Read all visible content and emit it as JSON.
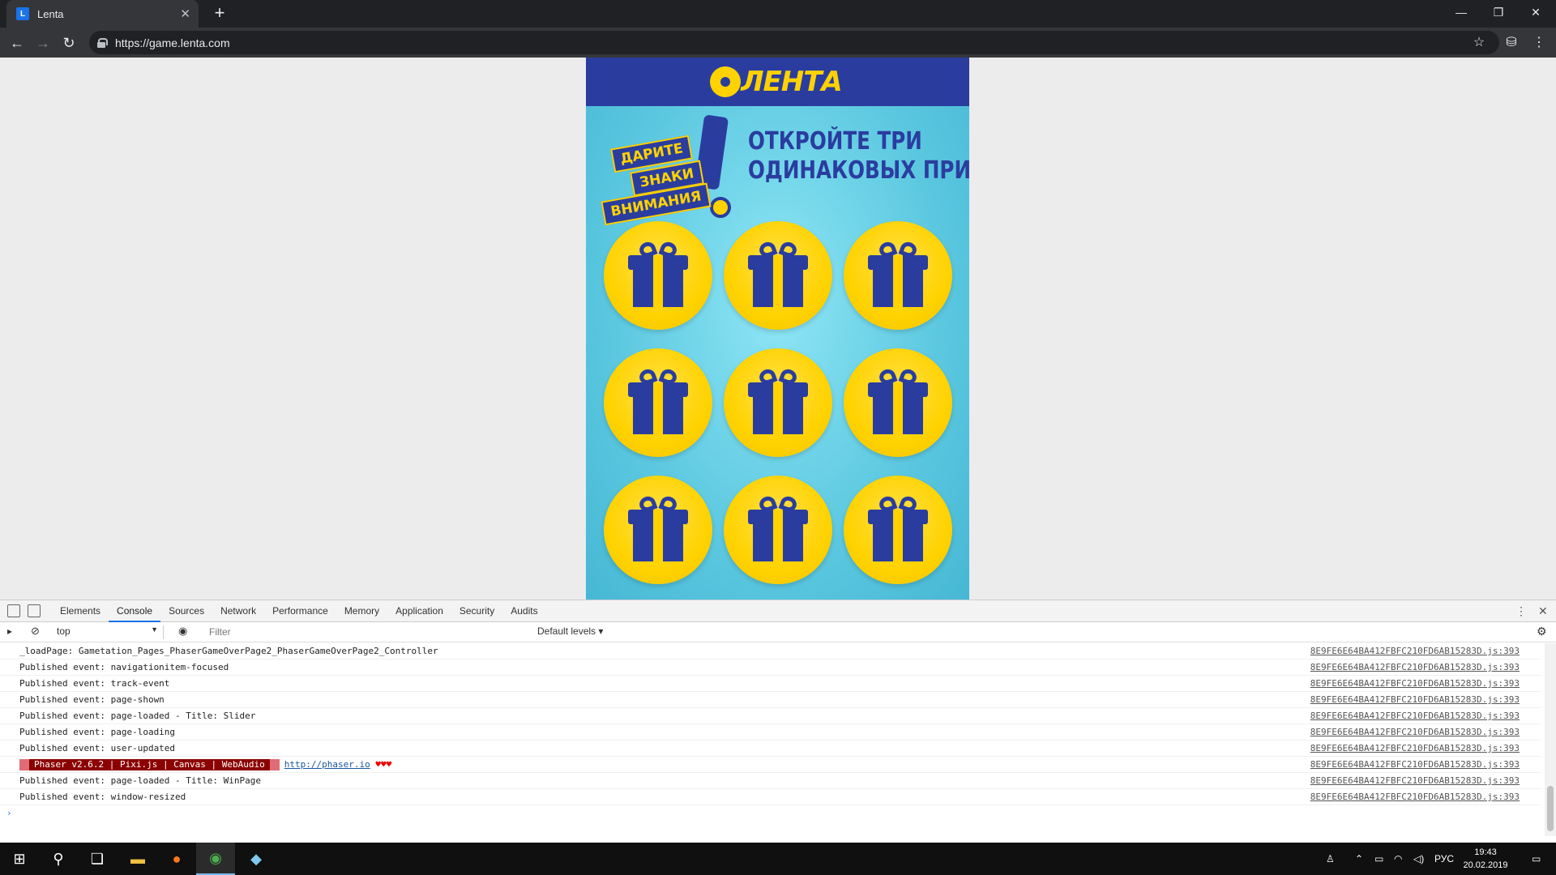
{
  "browser": {
    "tab_title": "Lenta",
    "tab_favicon": "lenta-favicon-icon",
    "url": "https://game.lenta.com"
  },
  "game": {
    "logo_text": "ЛЕНТА",
    "promo_lines": [
      "ДАРИТЕ",
      "ЗНАКИ",
      "ВНИМАНИЯ"
    ],
    "headline_1": "ОТКРОЙТЕ ТРИ",
    "headline_2": "ОДИНАКОВЫХ ПРИЗА!",
    "prizes": 9,
    "colors": {
      "brand_blue": "#2a3d9f",
      "brand_yellow": "#ffd200",
      "background": "#5cc8e0"
    }
  },
  "devtools": {
    "tabs": [
      "Elements",
      "Console",
      "Sources",
      "Network",
      "Performance",
      "Memory",
      "Application",
      "Security",
      "Audits"
    ],
    "active_tab": "Console",
    "context": "top",
    "filter_placeholder": "Filter",
    "levels": "Default levels ▾",
    "logs": [
      {
        "text": "_loadPage: Gametation_Pages_PhaserGameOverPage2_PhaserGameOverPage2_Controller",
        "src": "8E9FE6E64BA412FBFC210FD6AB15283D.js:393"
      },
      {
        "text": "Published event: navigationitem-focused",
        "src": "8E9FE6E64BA412FBFC210FD6AB15283D.js:393"
      },
      {
        "text": "Published event: track-event",
        "src": "8E9FE6E64BA412FBFC210FD6AB15283D.js:393"
      },
      {
        "text": "Published event: page-shown",
        "src": "8E9FE6E64BA412FBFC210FD6AB15283D.js:393"
      },
      {
        "text": "Published event: page-loaded - Title: Slider",
        "src": "8E9FE6E64BA412FBFC210FD6AB15283D.js:393"
      },
      {
        "text": "Published event: page-loading",
        "src": "8E9FE6E64BA412FBFC210FD6AB15283D.js:393"
      },
      {
        "text": "Published event: user-updated",
        "src": "8E9FE6E64BA412FBFC210FD6AB15283D.js:393"
      },
      {
        "text": "Published event: page-loaded - Title: WinPage",
        "src": "8E9FE6E64BA412FBFC210FD6AB15283D.js:393"
      },
      {
        "text": "Published event: window-resized",
        "src": "8E9FE6E64BA412FBFC210FD6AB15283D.js:393"
      }
    ],
    "phaser_banner": {
      "text": "Phaser v2.6.2 | Pixi.js | Canvas | WebAudio",
      "link": "http://phaser.io",
      "hearts": "♥♥♥",
      "src": "8E9FE6E64BA412FBFC210FD6AB15283D.js:393"
    }
  },
  "taskbar": {
    "lang": "РУС",
    "time": "19:43",
    "date": "20.02.2019"
  }
}
